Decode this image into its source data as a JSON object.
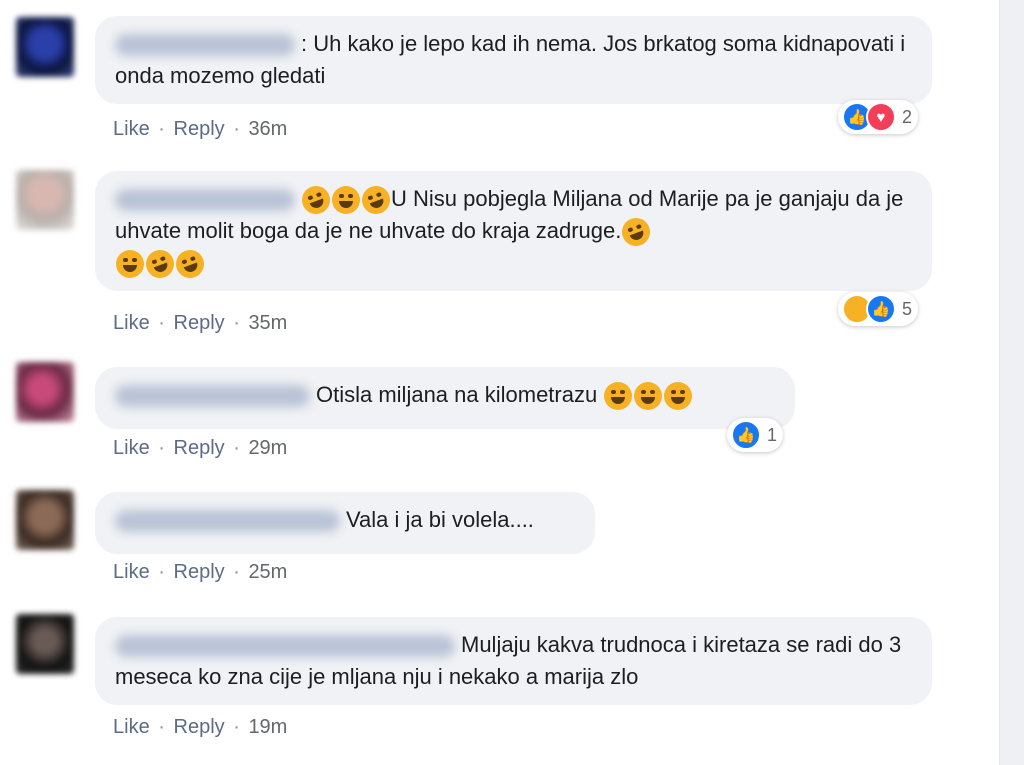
{
  "actions": {
    "like": "Like",
    "reply": "Reply",
    "dot": "·"
  },
  "colors": {
    "bubble": "#f0f2f5",
    "link": "#5b6b88",
    "like": "#1877f2",
    "love": "#f33e58",
    "haha": "#f7b125"
  },
  "comments": [
    {
      "text_prefix": ": ",
      "text": "Uh kako je lepo kad ih nema. Jos brkatog soma kidnapovati i onda mozemo gledati",
      "time": "36m",
      "reactions": {
        "icons": [
          "like-icon",
          "love-icon"
        ],
        "count": "2"
      }
    },
    {
      "text": "U Nisu pobjegla Miljana od Marije pa je ganjaju da je uhvate molit boga da je ne uhvate do kraja zadruge.",
      "emoji": "rolling-laughing-emoji",
      "time": "35m",
      "reactions": {
        "icons": [
          "haha-icon",
          "like-icon"
        ],
        "count": "5"
      }
    },
    {
      "text": "Otisla miljana na kilometrazu",
      "emoji": "grinning-emoji",
      "time": "29m",
      "reactions": {
        "icons": [
          "like-icon"
        ],
        "count": "1"
      }
    },
    {
      "text": "Vala i ja bi volela....",
      "time": "25m"
    },
    {
      "text": "Muljaju kakva trudnoca i kiretaza se radi do 3 meseca ko zna cije je mljana nju i nekako a marija zlo",
      "time": "19m"
    }
  ]
}
